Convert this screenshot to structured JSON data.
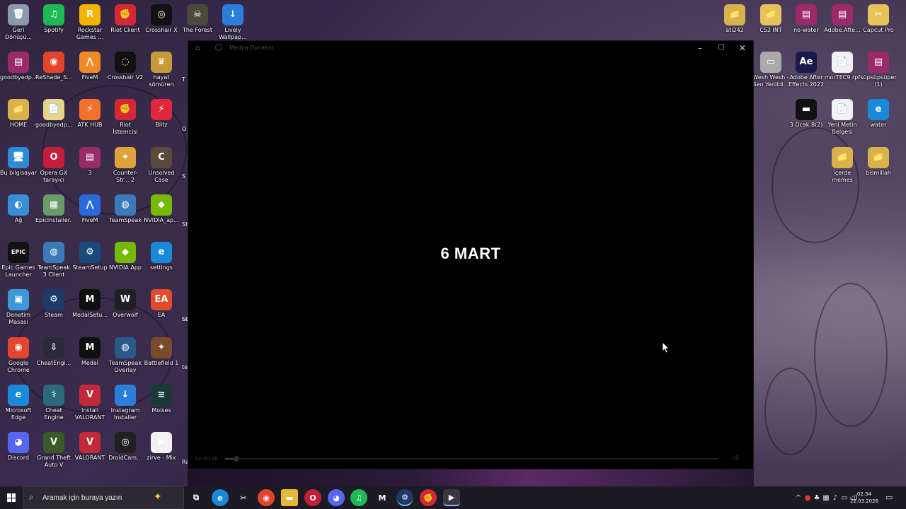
{
  "desktop": {
    "icons": [
      {
        "id": "geri-donusum",
        "label": "Geri Dönüşü...",
        "glyph": "🗑",
        "color": "#8a9aac"
      },
      {
        "id": "spotify",
        "label": "Spotify",
        "glyph": "♫",
        "color": "#1db954"
      },
      {
        "id": "rockstar",
        "label": "Rockstar Games ...",
        "glyph": "R",
        "color": "#f5b400"
      },
      {
        "id": "riot-client",
        "label": "Riot Client",
        "glyph": "✊",
        "color": "#d32936"
      },
      {
        "id": "crosshair-x",
        "label": "Crosshair X",
        "glyph": "◎",
        "color": "#111111"
      },
      {
        "id": "the-forest",
        "label": "The Forest",
        "glyph": "☠",
        "color": "#4a4a3a"
      },
      {
        "id": "lively",
        "label": "Lively Wallpap...",
        "glyph": "↓",
        "color": "#2b7fd9"
      },
      {
        "id": "goodbyedp1",
        "label": "goodbyedp...",
        "glyph": "▤",
        "color": "#9b2a6a"
      },
      {
        "id": "reshade",
        "label": "ReShade_S...",
        "glyph": "◉",
        "color": "#e3452a"
      },
      {
        "id": "fivem1",
        "label": "FiveM",
        "glyph": "⋀",
        "color": "#f08a24"
      },
      {
        "id": "crosshair-v2",
        "label": "Crosshair V2",
        "glyph": "◌",
        "color": "#101010"
      },
      {
        "id": "hayat-somuren",
        "label": "hayat sömüren",
        "glyph": "♛",
        "color": "#c49a3a"
      },
      {
        "id": "home",
        "label": "HOME",
        "glyph": "📁",
        "color": "#d8b34a"
      },
      {
        "id": "goodbyedp2",
        "label": "goodbyedp...",
        "glyph": "📄",
        "color": "#e6d48a"
      },
      {
        "id": "atk-hub",
        "label": "ATK HUB",
        "glyph": "⚡",
        "color": "#f2722b"
      },
      {
        "id": "riot-istemci",
        "label": "Riot İstemcisi",
        "glyph": "✊",
        "color": "#d32936"
      },
      {
        "id": "blitz",
        "label": "Blitz",
        "glyph": "⚡",
        "color": "#e0283c"
      },
      {
        "id": "bu-bilgisayar",
        "label": "Bu bilgisayar",
        "glyph": "🖥",
        "color": "#2f8ad8"
      },
      {
        "id": "opera-gx",
        "label": "Opera GX tarayıcı",
        "glyph": "O",
        "color": "#c21e3a"
      },
      {
        "id": "three",
        "label": "3",
        "glyph": "▤",
        "color": "#9b2a6a"
      },
      {
        "id": "counter-strike",
        "label": "Counter-Str... 2",
        "glyph": "✦",
        "color": "#e0a23a"
      },
      {
        "id": "unsolved-case",
        "label": "Unsolved Case",
        "glyph": "C",
        "color": "#5a4a3a"
      },
      {
        "id": "ag",
        "label": "Ağ",
        "glyph": "◐",
        "color": "#3a8ed8"
      },
      {
        "id": "epic-installer",
        "label": "EpicInstaller...",
        "glyph": "▦",
        "color": "#6a9a6a"
      },
      {
        "id": "fivem2",
        "label": "FiveM",
        "glyph": "⋀",
        "color": "#2a6ad8"
      },
      {
        "id": "teamspeak",
        "label": "TeamSpeak",
        "glyph": "◍",
        "color": "#3a7ab8"
      },
      {
        "id": "nvidia-ap",
        "label": "NVIDIA_ap...",
        "glyph": "◆",
        "color": "#76b900"
      },
      {
        "id": "epic-games",
        "label": "Epic Games Launcher",
        "glyph": "EPIC",
        "color": "#111111"
      },
      {
        "id": "teamspeak3",
        "label": "TeamSpeak 3 Client",
        "glyph": "◍",
        "color": "#3a7ab8"
      },
      {
        "id": "steam-setup",
        "label": "SteamSetup",
        "glyph": "⚙",
        "color": "#1a4a7a"
      },
      {
        "id": "nvidia-app",
        "label": "NVIDIA App",
        "glyph": "◆",
        "color": "#76b900"
      },
      {
        "id": "settings",
        "label": "settings",
        "glyph": "e",
        "color": "#1a8ad8"
      },
      {
        "id": "denetim",
        "label": "Denetim Masası",
        "glyph": "▣",
        "color": "#3a9ad8"
      },
      {
        "id": "steam",
        "label": "Steam",
        "glyph": "⚙",
        "color": "#1a3a6a"
      },
      {
        "id": "medal-setup",
        "label": "MedalSetu...",
        "glyph": "M",
        "color": "#101010"
      },
      {
        "id": "overwolf",
        "label": "Overwolf",
        "glyph": "W",
        "color": "#202020"
      },
      {
        "id": "ea",
        "label": "EA",
        "glyph": "EA",
        "color": "#e24a2a"
      },
      {
        "id": "chrome",
        "label": "Google Chrome",
        "glyph": "◉",
        "color": "#e4452f"
      },
      {
        "id": "cheat-engi",
        "label": "CheatEngi...",
        "glyph": "⇩",
        "color": "#2a2a3a"
      },
      {
        "id": "medal",
        "label": "Medal",
        "glyph": "M",
        "color": "#101010"
      },
      {
        "id": "ts-overlay",
        "label": "TeamSpeak Overlay",
        "glyph": "◍",
        "color": "#2a5a8a"
      },
      {
        "id": "battlefield",
        "label": "Battlefield 1",
        "glyph": "✦",
        "color": "#7a4a2a"
      },
      {
        "id": "edge",
        "label": "Microsoft Edge",
        "glyph": "e",
        "color": "#1a8ad8"
      },
      {
        "id": "cheat-engine",
        "label": "Cheat Engine",
        "glyph": "⚕",
        "color": "#2a6a7a"
      },
      {
        "id": "install-valorant",
        "label": "Install VALORANT",
        "glyph": "V",
        "color": "#c22a3a"
      },
      {
        "id": "instagram",
        "label": "Instagram Installer",
        "glyph": "↓",
        "color": "#2b7fd9"
      },
      {
        "id": "moises",
        "label": "Moises",
        "glyph": "≋",
        "color": "#1a3a3a"
      },
      {
        "id": "discord",
        "label": "Discord",
        "glyph": "◕",
        "color": "#5865f2"
      },
      {
        "id": "gta5",
        "label": "Grand Theft Auto V",
        "glyph": "V",
        "color": "#3a5a2a"
      },
      {
        "id": "valorant",
        "label": "VALORANT",
        "glyph": "V",
        "color": "#c22a3a"
      },
      {
        "id": "droidcam",
        "label": "DroidCam...",
        "glyph": "◎",
        "color": "#202020"
      },
      {
        "id": "zirve-mix",
        "label": "zirve - Mix",
        "glyph": "▶",
        "color": "#f2f2f2"
      }
    ],
    "right_icons": [
      {
        "id": "ati242",
        "label": "ati242",
        "glyph": "📁",
        "color": "#d8b34a"
      },
      {
        "id": "cs2-int",
        "label": "CS2 INT",
        "glyph": "📁",
        "color": "#e6c35a"
      },
      {
        "id": "no-water",
        "label": "no-water",
        "glyph": "▤",
        "color": "#9b2a6a"
      },
      {
        "id": "adobe-afte",
        "label": "Adobe.Afte...",
        "glyph": "▤",
        "color": "#9b2a6a"
      },
      {
        "id": "capcut",
        "label": "Capcut Pro",
        "glyph": "✂",
        "color": "#e6c35a"
      },
      {
        "id": "wesh",
        "label": "Wesh Wesh - Sen Yenildi...",
        "glyph": "▭",
        "color": "#aaaaaa"
      },
      {
        "id": "after-effects",
        "label": "Adobe After Effects 2022",
        "glyph": "Ae",
        "color": "#1a1a4a"
      },
      {
        "id": "mortec",
        "label": "morTEC9.rpf",
        "glyph": "📄",
        "color": "#f2f2f2"
      },
      {
        "id": "supsupsuper",
        "label": "süpsüpsüper (1)",
        "glyph": "▤",
        "color": "#9b2a6a"
      },
      {
        "id": "ocak",
        "label": "3 Ocak 8(2)",
        "glyph": "▬",
        "color": "#111111"
      },
      {
        "id": "yeni-metin",
        "label": "Yeni Metin Belgesi",
        "glyph": "📄",
        "color": "#f2f2f2"
      },
      {
        "id": "water",
        "label": "water",
        "glyph": "e",
        "color": "#1a8ad8"
      },
      {
        "id": "icerde",
        "label": "içerde memes",
        "glyph": "📁",
        "color": "#d8b34a"
      },
      {
        "id": "bismillah",
        "label": "bismillah",
        "glyph": "📁",
        "color": "#d8b34a"
      }
    ],
    "edge_labels": [
      "T",
      "O",
      "S",
      "St",
      "Le",
      "St",
      "te",
      "Ra"
    ]
  },
  "player": {
    "title": "Medya Oynatıcı",
    "caption": "6 MART",
    "time": "00:00:26",
    "progress": 0.02,
    "minimize": "–",
    "maximize": "☐",
    "close": "✕",
    "volume_icon": "◁)"
  },
  "taskbar": {
    "search_placeholder": "Aramak için buraya yazın",
    "apps": [
      {
        "id": "task-view",
        "glyph": "⧉",
        "color": "transparent"
      },
      {
        "id": "edge",
        "glyph": "e",
        "color": "#1a8ad8"
      },
      {
        "id": "capcut",
        "glyph": "✂",
        "color": "transparent"
      },
      {
        "id": "chrome",
        "glyph": "◉",
        "color": "#e4452f"
      },
      {
        "id": "explorer",
        "glyph": "▬",
        "color": "#e6b83a"
      },
      {
        "id": "opera",
        "glyph": "O",
        "color": "#c21e3a"
      },
      {
        "id": "discord",
        "glyph": "◕",
        "color": "#5865f2"
      },
      {
        "id": "spotify",
        "glyph": "♫",
        "color": "#1db954"
      },
      {
        "id": "medal",
        "glyph": "M",
        "color": "transparent"
      },
      {
        "id": "steam",
        "glyph": "⚙",
        "color": "#1a3a6a"
      },
      {
        "id": "riot",
        "glyph": "✊",
        "color": "#d32936"
      },
      {
        "id": "media-player",
        "glyph": "▶",
        "color": "transparent"
      }
    ],
    "tray_glyphs": [
      "^",
      "●",
      "♣",
      "▦",
      "♪",
      "▭",
      "◁)"
    ],
    "clock_time": "02:34",
    "clock_date": "22.03.2026"
  }
}
